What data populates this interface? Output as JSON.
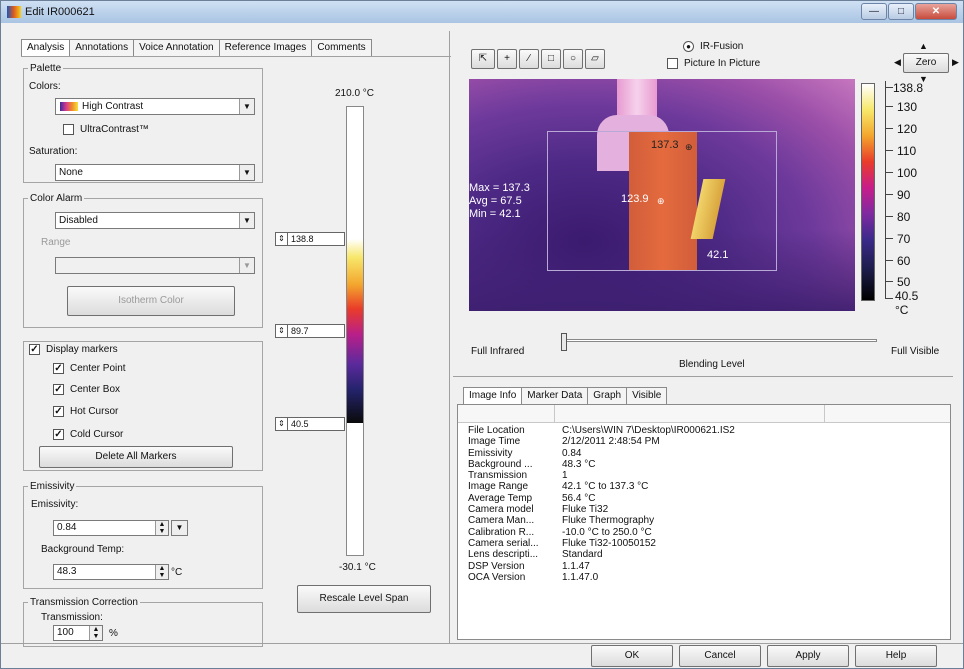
{
  "window": {
    "title": "Edit IR000621"
  },
  "tabs": [
    "Analysis",
    "Annotations",
    "Voice Annotation",
    "Reference Images",
    "Comments"
  ],
  "palette": {
    "legend": "Palette",
    "colors_label": "Colors:",
    "colors_value": "High Contrast",
    "ultracontrast_label": "UltraContrast™",
    "saturation_label": "Saturation:",
    "saturation_value": "None"
  },
  "color_alarm": {
    "legend": "Color Alarm",
    "value": "Disabled",
    "range_label": "Range",
    "isotherm_button": "Isotherm Color"
  },
  "markers": {
    "display_label": "Display markers",
    "center_point": "Center Point",
    "center_box": "Center Box",
    "hot_cursor": "Hot Cursor",
    "cold_cursor": "Cold Cursor",
    "delete_button": "Delete All Markers"
  },
  "emissivity": {
    "legend": "Emissivity",
    "emissivity_label": "Emissivity:",
    "emissivity_value": "0.84",
    "bg_label": "Background Temp:",
    "bg_value": "48.3",
    "bg_unit": "°C"
  },
  "transmission": {
    "legend": "Transmission Correction",
    "label": "Transmission:",
    "value": "100",
    "unit": "%"
  },
  "level_span": {
    "top": "210.0 °C",
    "bottom": "-30.1 °C",
    "marker_high": "138.8",
    "marker_mid": "89.7",
    "marker_low": "40.5",
    "rescale_button": "Rescale Level Span"
  },
  "toolbar": {
    "irfusion_label": "IR-Fusion",
    "pip_label": "Picture In Picture",
    "zero_label": "Zero"
  },
  "image": {
    "stats": {
      "max": "Max = 137.3",
      "avg": "Avg = 67.5",
      "min": "Min = 42.1"
    },
    "hot_label": "137.3",
    "center_label": "123.9",
    "cold_label": "42.1"
  },
  "temp_scale": {
    "top": "138.8",
    "ticks": [
      "130",
      "120",
      "110",
      "100",
      "90",
      "80",
      "70",
      "60",
      "50"
    ],
    "bottom": "40.5",
    "unit": "°C"
  },
  "blending": {
    "left": "Full Infrared",
    "center": "Blending Level",
    "right": "Full Visible"
  },
  "info_tabs": [
    "Image Info",
    "Marker Data",
    "Graph",
    "Visible"
  ],
  "info_rows": [
    {
      "k": "File Location",
      "v": "C:\\Users\\WIN 7\\Desktop\\IR000621.IS2"
    },
    {
      "k": "Image Time",
      "v": "2/12/2011 2:48:54 PM"
    },
    {
      "k": "Emissivity",
      "v": "0.84"
    },
    {
      "k": "Background ...",
      "v": "48.3 °C"
    },
    {
      "k": "Transmission",
      "v": "1"
    },
    {
      "k": "Image Range",
      "v": "42.1 °C to 137.3 °C"
    },
    {
      "k": "Average Temp",
      "v": "56.4 °C"
    },
    {
      "k": "Camera model",
      "v": "Fluke Ti32"
    },
    {
      "k": "Camera Man...",
      "v": "Fluke Thermography"
    },
    {
      "k": "Calibration R...",
      "v": "-10.0 °C to 250.0 °C"
    },
    {
      "k": "Camera serial...",
      "v": "Fluke Ti32-10050152"
    },
    {
      "k": "Lens descripti...",
      "v": "Standard"
    },
    {
      "k": "DSP Version",
      "v": "1.1.47"
    },
    {
      "k": "OCA Version",
      "v": "1.1.47.0"
    }
  ],
  "buttons": {
    "ok": "OK",
    "cancel": "Cancel",
    "apply": "Apply",
    "help": "Help"
  }
}
